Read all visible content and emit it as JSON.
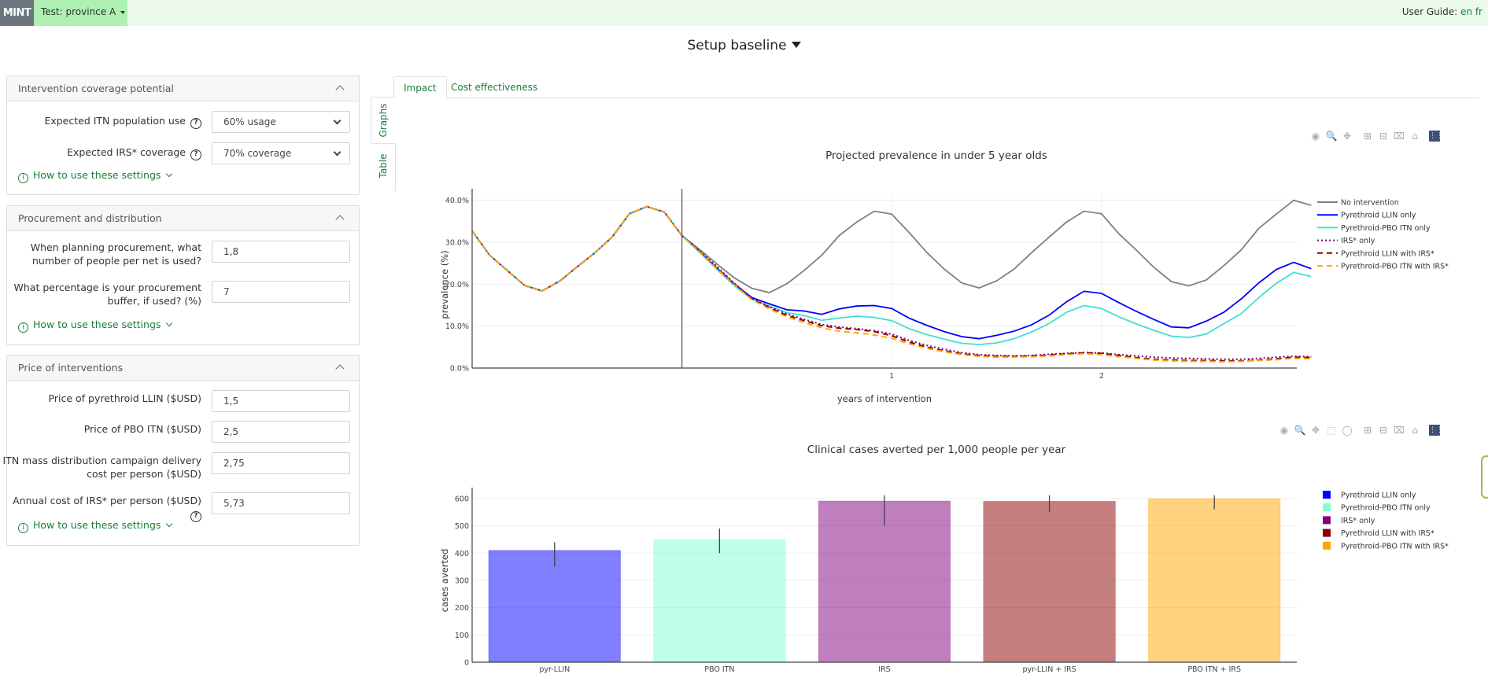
{
  "topbar": {
    "brand": "MINT",
    "project": "Test:  province A",
    "guide_label": "User Guide: ",
    "guide_links": [
      "en",
      "fr"
    ]
  },
  "page_title": "Setup baseline",
  "panels": [
    {
      "title": "Intervention coverage potential",
      "fields": [
        {
          "label": "Expected ITN population use",
          "help": true,
          "type": "select",
          "value": "60% usage"
        },
        {
          "label": "Expected IRS* coverage",
          "help": true,
          "type": "select",
          "value": "70% coverage"
        }
      ],
      "howto": "How to use these settings"
    },
    {
      "title": "Procurement and distribution",
      "fields": [
        {
          "label": "When planning procurement, what number of people per net is used?",
          "help": false,
          "type": "input",
          "value": "1,8"
        },
        {
          "label": "What percentage is your procurement buffer, if used? (%)",
          "help": false,
          "type": "input",
          "value": "7"
        }
      ],
      "howto": "How to use these settings"
    },
    {
      "title": "Price of interventions",
      "fields": [
        {
          "label": "Price of pyrethroid LLIN ($USD)",
          "help": false,
          "type": "input",
          "value": "1,5"
        },
        {
          "label": "Price of PBO ITN ($USD)",
          "help": false,
          "type": "input",
          "value": "2,5"
        },
        {
          "label": "ITN mass distribution campaign delivery cost per person ($USD)",
          "help": false,
          "type": "input",
          "value": "2,75"
        },
        {
          "label": "Annual cost of IRS* per person ($USD)",
          "help": true,
          "type": "input",
          "value": "5,73"
        }
      ],
      "howto": "How to use these settings"
    }
  ],
  "tabs": [
    {
      "label": "Impact",
      "active": true
    },
    {
      "label": "Cost effectiveness",
      "active": false
    }
  ],
  "vtabs": [
    {
      "label": "Graphs",
      "active": true
    },
    {
      "label": "Table",
      "active": false
    }
  ],
  "icons": {
    "help": "?",
    "info": "i",
    "modebar_prevalence": [
      "camera-icon",
      "zoom-icon",
      "pan-icon",
      "zoom-in-icon",
      "zoom-out-icon",
      "autoscale-icon",
      "reset-axes-icon",
      "plotly-logo-icon"
    ],
    "modebar_cases": [
      "camera-icon",
      "zoom-icon",
      "pan-icon",
      "box-select-icon",
      "lasso-select-icon",
      "zoom-in-icon",
      "zoom-out-icon",
      "autoscale-icon",
      "reset-axes-icon",
      "plotly-logo-icon"
    ]
  },
  "chart_data": [
    {
      "type": "line",
      "title": "Projected prevalence in under 5 year olds",
      "xlabel": "years of intervention",
      "ylabel": "prevalence (%)",
      "xlim": [
        -1.0,
        2.93
      ],
      "ylim": [
        0,
        42
      ],
      "xticks": [
        1,
        2
      ],
      "yticks": [
        0,
        10,
        20,
        30,
        40
      ],
      "ytick_labels": [
        "0.0%",
        "10.0%",
        "20.0%",
        "30.0%",
        "40.0%"
      ],
      "grid": true,
      "intervention_start": 0,
      "legend_position": "right",
      "x_start": -1.0,
      "x_step_years": 0.0833,
      "pre_intervention": [
        32.7,
        26.9,
        23.3,
        19.7,
        18.4,
        20.7,
        24.1,
        27.4,
        31.2,
        36.8,
        38.5,
        37.2,
        31.6
      ],
      "series": [
        {
          "name": "No intervention",
          "color": "#808080",
          "dash": "solid",
          "values": [
            31.6,
            28.3,
            24.8,
            21.5,
            19.0,
            18.0,
            20.1,
            23.3,
            26.9,
            31.6,
            34.8,
            37.4,
            36.7,
            32.3,
            27.6,
            23.6,
            20.3,
            19.1,
            20.8,
            23.6,
            27.5,
            31.2,
            34.8,
            37.4,
            36.8,
            32.0,
            28.1,
            24.0,
            20.6,
            19.6,
            21.0,
            24.4,
            28.2,
            33.3,
            36.7,
            40.0,
            38.8
          ]
        },
        {
          "name": "Pyrethroid LLIN only",
          "color": "#0000ff",
          "dash": "solid",
          "values": [
            31.6,
            27.8,
            23.8,
            20.0,
            16.8,
            15.3,
            13.9,
            13.6,
            12.8,
            14.1,
            14.8,
            14.9,
            14.2,
            11.9,
            10.2,
            8.7,
            7.5,
            7.0,
            7.8,
            8.8,
            10.3,
            12.6,
            15.8,
            18.3,
            17.8,
            15.6,
            13.5,
            11.6,
            9.8,
            9.6,
            11.2,
            13.3,
            16.5,
            20.3,
            23.5,
            25.2,
            23.7
          ]
        },
        {
          "name": "Pyrethroid-PBO ITN only",
          "color": "#40e0d0",
          "dash": "solid",
          "values": [
            31.6,
            27.6,
            23.5,
            19.6,
            16.4,
            14.8,
            13.2,
            12.5,
            11.4,
            11.9,
            12.4,
            12.1,
            11.3,
            9.4,
            8.0,
            6.9,
            5.9,
            5.6,
            6.0,
            7.0,
            8.6,
            10.6,
            13.3,
            14.9,
            14.2,
            12.2,
            10.5,
            9.0,
            7.6,
            7.3,
            8.1,
            10.6,
            13.0,
            16.8,
            20.2,
            22.8,
            21.8
          ]
        },
        {
          "name": "IRS* only",
          "color": "#800080",
          "dash": "dot",
          "values": [
            31.6,
            28.0,
            24.2,
            20.2,
            16.6,
            14.6,
            12.9,
            11.6,
            10.4,
            9.8,
            9.4,
            8.9,
            8.1,
            6.6,
            5.4,
            4.5,
            3.7,
            3.2,
            3.0,
            2.9,
            3.0,
            3.3,
            3.5,
            3.7,
            3.6,
            3.2,
            2.9,
            2.6,
            2.4,
            2.3,
            2.2,
            2.1,
            2.1,
            2.3,
            2.6,
            2.8,
            2.7
          ]
        },
        {
          "name": "Pyrethroid LLIN with IRS*",
          "color": "#8b0000",
          "dash": "dash",
          "values": [
            31.6,
            27.8,
            23.9,
            20.0,
            16.5,
            14.4,
            12.6,
            11.3,
            10.1,
            9.5,
            9.2,
            8.7,
            7.7,
            6.2,
            5.0,
            4.1,
            3.4,
            3.0,
            2.8,
            2.8,
            2.9,
            3.1,
            3.4,
            3.6,
            3.5,
            3.0,
            2.5,
            2.1,
            1.9,
            1.8,
            1.8,
            1.7,
            1.7,
            1.9,
            2.2,
            2.6,
            2.5
          ]
        },
        {
          "name": "Pyrethroid-PBO ITN with IRS*",
          "color": "#ffa500",
          "dash": "dash",
          "values": [
            31.6,
            27.7,
            23.7,
            19.8,
            16.3,
            14.1,
            12.2,
            10.8,
            9.6,
            8.8,
            8.4,
            7.9,
            7.1,
            5.8,
            4.7,
            3.9,
            3.2,
            2.8,
            2.6,
            2.6,
            2.7,
            2.9,
            3.2,
            3.4,
            3.2,
            2.7,
            2.3,
            1.9,
            1.7,
            1.6,
            1.6,
            1.5,
            1.6,
            1.8,
            2.0,
            2.3,
            2.2
          ]
        }
      ]
    },
    {
      "type": "bar",
      "title": "Clinical cases averted per 1,000 people per year",
      "xlabel": "",
      "ylabel": "cases averted",
      "ylim": [
        0,
        640
      ],
      "yticks": [
        0,
        100,
        200,
        300,
        400,
        500,
        600
      ],
      "grid": true,
      "legend_position": "right",
      "categories": [
        "pyr-LLIN",
        "PBO ITN",
        "IRS",
        "pyr-LLIN + IRS",
        "PBO ITN + IRS"
      ],
      "values": [
        410,
        450,
        591,
        590,
        600
      ],
      "error_low": [
        350,
        400,
        500,
        550,
        560
      ],
      "error_high": [
        440,
        490,
        612,
        612,
        612
      ],
      "colors": [
        "#0000ff",
        "#7fffd4",
        "#800080",
        "#8b0000",
        "#ffa500"
      ],
      "legend": [
        "Pyrethroid LLIN only",
        "Pyrethroid-PBO ITN only",
        "IRS* only",
        "Pyrethroid LLIN with IRS*",
        "Pyrethroid-PBO ITN with IRS*"
      ]
    }
  ]
}
